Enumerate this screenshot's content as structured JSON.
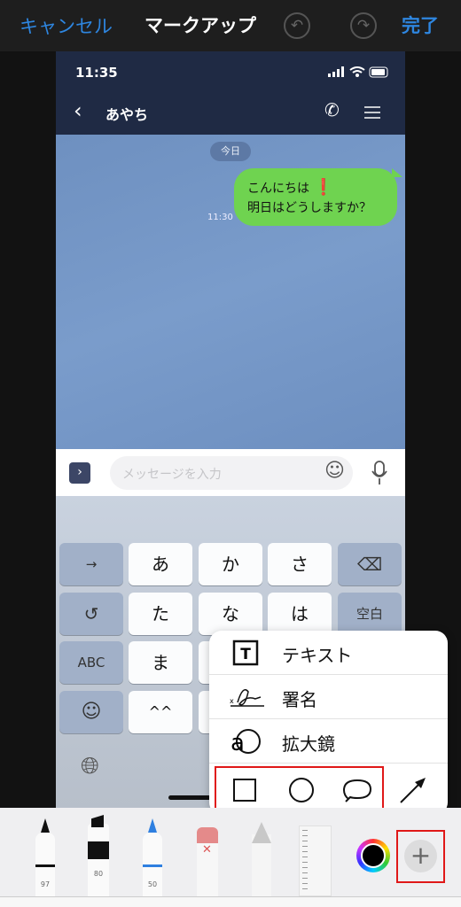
{
  "topbar": {
    "cancel": "キャンセル",
    "title": "マークアップ",
    "done": "完了",
    "undo_icon": "undo-icon",
    "redo_icon": "redo-icon"
  },
  "phone": {
    "status": {
      "time": "11:35"
    },
    "nav": {
      "contact": "あやち"
    },
    "chat": {
      "date_badge": "今日",
      "message_line1": "こんにちは",
      "message_line2": "明日はどうしますか？",
      "message_time": "11:30"
    },
    "input": {
      "placeholder": "メッセージを入力"
    },
    "keyboard": {
      "rows": [
        [
          "→",
          "あ",
          "か",
          "さ",
          "⌫"
        ],
        [
          "↺",
          "た",
          "な",
          "は",
          "空白"
        ],
        [
          "ABC",
          "ま",
          "",
          "",
          ""
        ],
        [
          "☺",
          "^^",
          "",
          "",
          ""
        ]
      ]
    }
  },
  "popup": {
    "items": [
      {
        "label": "テキスト",
        "icon": "text-box-icon"
      },
      {
        "label": "署名",
        "icon": "signature-icon"
      },
      {
        "label": "拡大鏡",
        "icon": "magnifier-icon"
      }
    ],
    "shapes": [
      "square-icon",
      "circle-icon",
      "speech-bubble-icon",
      "arrow-icon"
    ]
  },
  "toolbar": {
    "pen_width": "97",
    "marker_opacity": "80",
    "pencil_width": "50",
    "accent": "#2e86e0",
    "highlight": "#e01818"
  }
}
